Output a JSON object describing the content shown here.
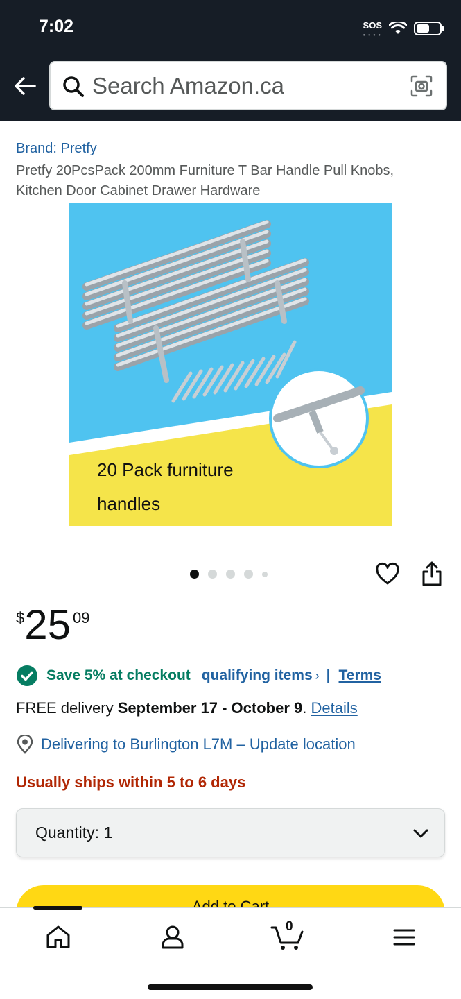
{
  "status_bar": {
    "time": "7:02",
    "sos": "SOS"
  },
  "search": {
    "placeholder": "Search Amazon.ca"
  },
  "product": {
    "brand": "Brand: Pretfy",
    "title": "Pretfy 20PcsPack 200mm Furniture T Bar Handle Pull Knobs, Kitchen Door Cabinet Drawer Hardware",
    "image_caption_line1": "20 Pack furniture",
    "image_caption_line2": "handles"
  },
  "price": {
    "symbol": "$",
    "whole": "25",
    "fraction": "09"
  },
  "promo": {
    "save_text": "Save 5% at checkout",
    "qualifying_link": "qualifying items",
    "chevron": "›",
    "separator": "|",
    "terms_link": "Terms"
  },
  "delivery": {
    "prefix": "FREE delivery ",
    "dates": "September 17 - October 9",
    "suffix": ". ",
    "details_link": "Details"
  },
  "location": {
    "text": "Delivering to Burlington L7M – Update location"
  },
  "shipping": {
    "text": "Usually ships within 5 to 6 days"
  },
  "quantity": {
    "label": "Quantity:",
    "value": "1"
  },
  "add_to_cart": {
    "label": "Add to Cart"
  },
  "tabs": {
    "cart_count": "0"
  },
  "colors": {
    "header_bg": "#161d26",
    "link_blue": "#2162a1",
    "promo_green": "#067d62",
    "shipping_red": "#b12704",
    "cart_yellow": "#ffd814",
    "image_blue": "#4fc3f0",
    "image_yellow": "#f5e44a"
  },
  "icons": [
    "back-arrow-icon",
    "search-icon",
    "camera-icon",
    "heart-icon",
    "share-icon",
    "check-circle-icon",
    "location-pin-icon",
    "chevron-down-icon",
    "home-icon",
    "account-icon",
    "cart-icon",
    "menu-icon"
  ]
}
